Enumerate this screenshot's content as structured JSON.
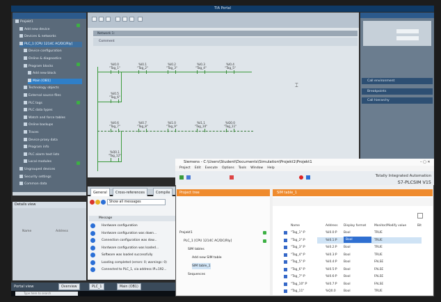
{
  "app": {
    "title": "TIA Portal"
  },
  "tree": {
    "items": [
      {
        "label": "Projekt1"
      },
      {
        "label": "Add new device"
      },
      {
        "label": "Devices & networks"
      },
      {
        "label": "PLC_1 [CPU 1214C AC/DC/Rly]"
      },
      {
        "label": "Device configuration"
      },
      {
        "label": "Online & diagnostics"
      },
      {
        "label": "Program blocks"
      },
      {
        "label": "Add new block"
      },
      {
        "label": "Main [OB1]"
      },
      {
        "label": "Technology objects"
      },
      {
        "label": "External source files"
      },
      {
        "label": "PLC tags"
      },
      {
        "label": "PLC data types"
      },
      {
        "label": "Watch and force tables"
      },
      {
        "label": "Online backups"
      },
      {
        "label": "Traces"
      },
      {
        "label": "Device proxy data"
      },
      {
        "label": "Program info"
      },
      {
        "label": "PLC alarm text lists"
      },
      {
        "label": "Local modules"
      },
      {
        "label": "Ungrouped devices"
      },
      {
        "label": "Security settings"
      },
      {
        "label": "Common data"
      }
    ],
    "details_view": "Details view",
    "details_cols": [
      "Name",
      "Address"
    ]
  },
  "editor": {
    "network_label": "Network 1:",
    "network_comment": "Comment",
    "row1": [
      "%I0.0\n\"Tag_1\"",
      "%I0.1\n\"Tag_2\"",
      "%I0.2\n\"Tag_3\"",
      "%I0.3\n\"Tag_4\"",
      "%I0.4\n\"Tag_5\""
    ],
    "row1b": "%I0.5\n\"Tag_6\"",
    "row2": [
      "%I0.6\n\"Tag_7\"",
      "%I0.7\n\"Tag_8\"",
      "%I1.0\n\"Tag_9\"",
      "%I1.1\n\"Tag_10\"",
      "%Q0.0\n\"Tag_11\""
    ],
    "row2b": "%Q0.1\n\"Tag_12\""
  },
  "right_panel": {
    "sections": [
      "Call environment",
      "Breakpoints",
      "Call hierarchy"
    ]
  },
  "inspector": {
    "tabs": [
      "General",
      "Cross-references",
      "Compile"
    ],
    "filter_label": "Show all messages",
    "message_header": "Message",
    "messages": [
      "Hardware configuration",
      "Hardware configuration was down...",
      "Connection configuration was dow...",
      "Hardware configuration was loaded...",
      "Software was loaded successfully",
      "Loading completed (errors: 0; warnings: 0)",
      "Connected to PLC_1, via address IP=192..."
    ]
  },
  "sim": {
    "title": "Siemens - C:\\Users\\Student\\Documents\\Simulation\\Projekt1\\Projekt1",
    "menu": [
      "Project",
      "Edit",
      "Execute",
      "Options",
      "Tools",
      "Window",
      "Help"
    ],
    "brand1": "Totally Integrated Automation",
    "brand2": "S7-PLCSIM V15",
    "project_nav_header": "Project tree",
    "project_items": [
      {
        "label": "Projekt1"
      },
      {
        "label": "PLC_1 [CPU 1214C AC/DC/Rly]"
      },
      {
        "label": "SIM tables"
      },
      {
        "label": "Add new SIM table"
      },
      {
        "label": "SIM table_1"
      },
      {
        "label": "Sequences"
      }
    ],
    "sim_table_header": "SIM table_1",
    "columns": [
      "Name",
      "Address",
      "Display format",
      "Monitor/Modify value",
      "Bit"
    ],
    "rows": [
      {
        "name": "\"Tag_1\":P",
        "address": "%I0.0:P",
        "format": "Bool",
        "value": "TRUE"
      },
      {
        "name": "\"Tag_2\":P",
        "address": "%I0.1:P",
        "format": "Bool",
        "value": "TRUE"
      },
      {
        "name": "\"Tag_3\":P",
        "address": "%I0.2:P",
        "format": "Bool",
        "value": "TRUE"
      },
      {
        "name": "\"Tag_4\":P",
        "address": "%I0.3:P",
        "format": "Bool",
        "value": "TRUE"
      },
      {
        "name": "\"Tag_5\":P",
        "address": "%I0.4:P",
        "format": "Bool",
        "value": "FALSE"
      },
      {
        "name": "\"Tag_6\":P",
        "address": "%I0.5:P",
        "format": "Bool",
        "value": "FALSE"
      },
      {
        "name": "\"Tag_7\":P",
        "address": "%I0.6:P",
        "format": "Bool",
        "value": "FALSE"
      },
      {
        "name": "\"Tag_10\":P",
        "address": "%I0.7:P",
        "format": "Bool",
        "value": "FALSE"
      },
      {
        "name": "\"Tag_11\"",
        "address": "%Q0.0",
        "format": "Bool",
        "value": "TRUE"
      }
    ]
  },
  "portal": {
    "label": "Portal view",
    "buttons": [
      "Overview",
      "PLC_1",
      "Main (OB1)"
    ]
  },
  "windows": {
    "search_placeholder": "Type here to search"
  }
}
